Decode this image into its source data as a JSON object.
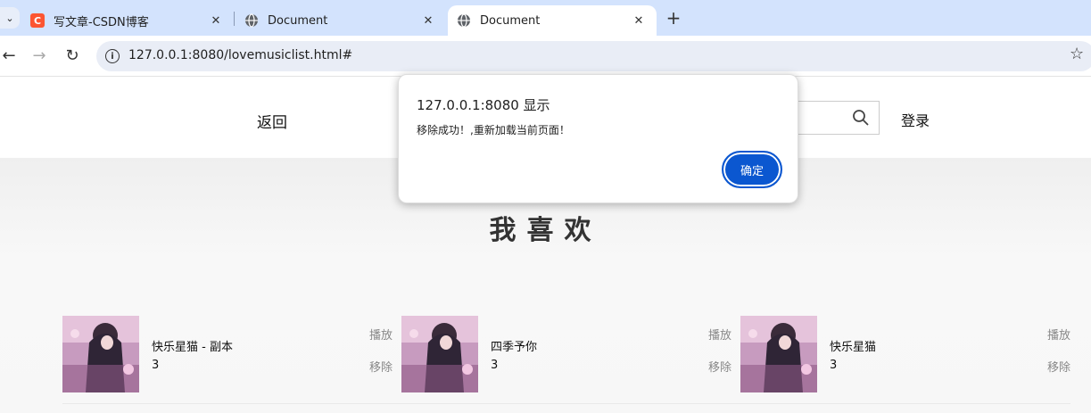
{
  "browser": {
    "tabs": [
      {
        "title": "写文章-CSDN博客",
        "icon": "csdn-icon",
        "icon_letter": "C"
      },
      {
        "title": "Document",
        "icon": "globe-icon"
      },
      {
        "title": "Document",
        "icon": "globe-icon",
        "active": true
      }
    ],
    "close_glyph": "✕",
    "new_tab_glyph": "+",
    "url": "127.0.0.1:8080/lovemusiclist.html#"
  },
  "page": {
    "back_label": "返回",
    "login_label": "登录",
    "heading": "我喜欢",
    "songs": [
      {
        "title": "快乐星猫 - 副本",
        "count": "3",
        "play": "播放",
        "remove": "移除"
      },
      {
        "title": "四季予你",
        "count": "3",
        "play": "播放",
        "remove": "移除"
      },
      {
        "title": "快乐星猫",
        "count": "3",
        "play": "播放",
        "remove": "移除"
      }
    ]
  },
  "dialog": {
    "title": "127.0.0.1:8080 显示",
    "message": "移除成功！,重新加载当前页面！",
    "ok_label": "确定"
  },
  "colors": {
    "tabstrip": "#d3e3fd",
    "accent": "#0b57d0",
    "csdn": "#fc5531"
  }
}
